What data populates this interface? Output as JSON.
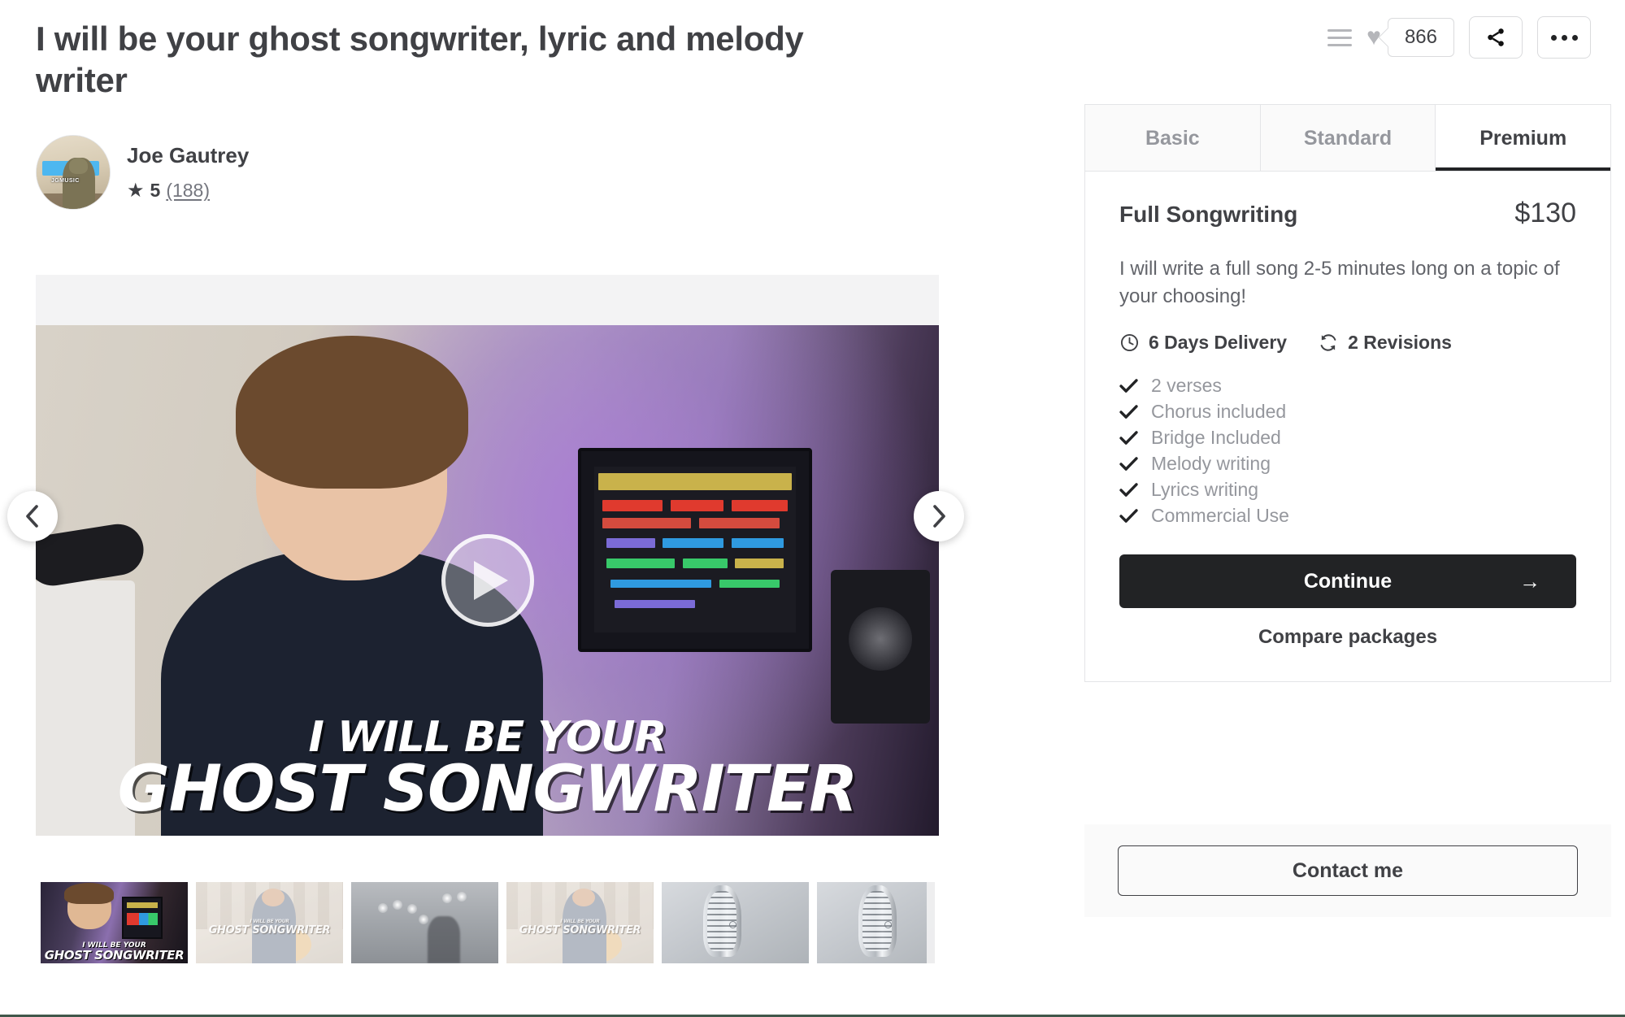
{
  "gig": {
    "title": "I will be your ghost songwriter, lyric and melody writer",
    "seller_name": "Joe Gautrey",
    "avatar_tag": "JGMUSIC",
    "rating_value": "5",
    "rating_count": "(188)",
    "star_glyph": "★"
  },
  "top_actions": {
    "collect_icon": "collect-lines-icon",
    "heart_icon": "heart-icon",
    "favorites_count": "866",
    "share_icon": "share-icon",
    "more_icon": "more-options-icon"
  },
  "gallery": {
    "prev_label": "‹",
    "next_label": "›",
    "play_label": "play",
    "caption_line1": "I WILL BE YOUR",
    "caption_line2": "GHOST SONGWRITER",
    "thumb_next_label": "›",
    "thumbnails": [
      {
        "name": "thumb-studio-intro",
        "caption_line1": "I WILL BE YOUR",
        "caption_line2": "GHOST SONGWRITER",
        "active": true
      },
      {
        "name": "thumb-guitar-1",
        "caption_line1": "I WILL BE YOUR",
        "caption_line2": "GHOST SONGWRITER",
        "active": false
      },
      {
        "name": "thumb-stage",
        "caption_line1": "",
        "caption_line2": "",
        "active": false
      },
      {
        "name": "thumb-guitar-2",
        "caption_line1": "I WILL BE YOUR",
        "caption_line2": "GHOST SONGWRITER",
        "active": false
      },
      {
        "name": "thumb-microphone-1",
        "caption_line1": "",
        "caption_line2": "",
        "active": false
      },
      {
        "name": "thumb-microphone-2",
        "caption_line1": "",
        "caption_line2": "",
        "active": false
      }
    ]
  },
  "packages": {
    "tabs": [
      {
        "label": "Basic",
        "active": false
      },
      {
        "label": "Standard",
        "active": false
      },
      {
        "label": "Premium",
        "active": true
      }
    ],
    "selected": {
      "name": "Full Songwriting",
      "price": "$130",
      "description": "I will write a full song 2-5 minutes long on a topic of your choosing!",
      "delivery": "6 Days Delivery",
      "revisions": "2 Revisions",
      "delivery_icon": "clock-icon",
      "revisions_icon": "refresh-icon",
      "features": [
        "2 verses",
        "Chorus included",
        "Bridge Included",
        "Melody writing",
        "Lyrics writing",
        "Commercial Use"
      ]
    },
    "continue_label": "Continue",
    "continue_arrow": "→",
    "compare_label": "Compare packages"
  },
  "contact": {
    "label": "Contact me"
  },
  "colors": {
    "text_primary": "#404145",
    "text_muted": "#95979d",
    "border": "#e4e5e7",
    "cta_bg": "#222325",
    "footer_rule": "#40574a"
  }
}
